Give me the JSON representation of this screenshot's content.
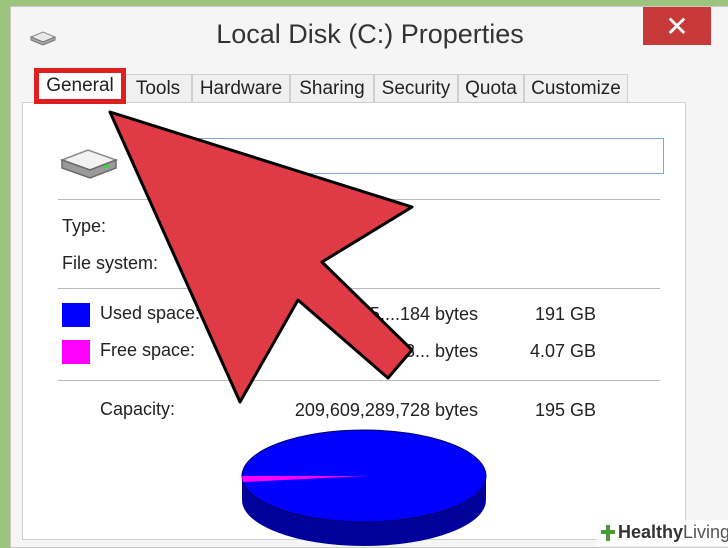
{
  "window": {
    "title": "Local Disk (C:) Properties",
    "close_label": "✕"
  },
  "tabs": [
    {
      "label": "General",
      "active": true
    },
    {
      "label": "Tools"
    },
    {
      "label": "Hardware"
    },
    {
      "label": "Sharing"
    },
    {
      "label": "Security"
    },
    {
      "label": "Quota"
    },
    {
      "label": "Customize"
    }
  ],
  "general": {
    "name_value": "",
    "type_label": "Type:",
    "filesystem_label": "File system:",
    "used": {
      "label": "Used space:",
      "bytes": "205,...184 bytes",
      "size": "191 GB",
      "color": "#0000ff"
    },
    "free": {
      "label": "Free space:",
      "bytes": "4,3... bytes",
      "size": "4.07 GB",
      "color": "#ff00ff"
    },
    "capacity": {
      "label": "Capacity:",
      "bytes": "209,609,289,728 bytes",
      "size": "195 GB"
    },
    "pie": {
      "used_fraction": 0.979,
      "free_fraction": 0.021
    }
  },
  "annotation": {
    "highlight_color": "#e02020",
    "arrow_color": "#e03a46"
  },
  "watermark": {
    "brand_bold": "Healthy",
    "brand_rest": "Living"
  }
}
